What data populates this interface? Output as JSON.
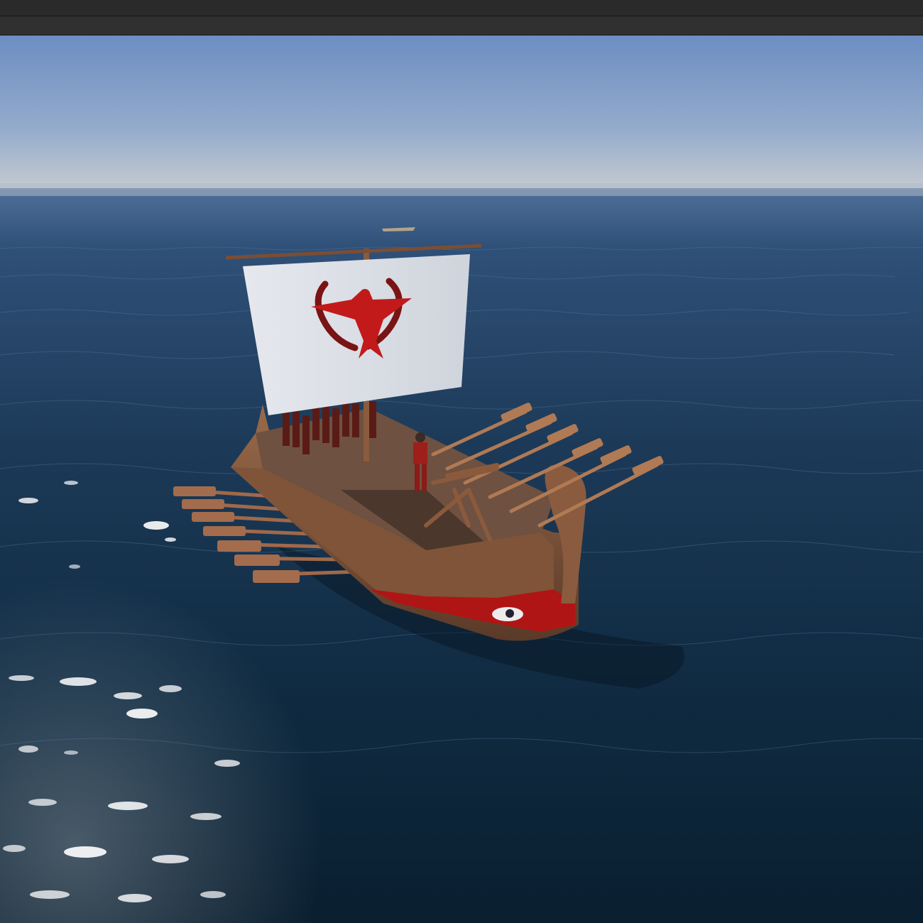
{
  "window": {
    "toolbar_items": []
  },
  "scene": {
    "description_visible_text": [],
    "colors": {
      "sky_top": "#6d8fc2",
      "sky_horizon": "#b8c4cf",
      "sea_far": "#3a5a82",
      "sea_mid": "#1d3a55",
      "sea_near": "#0b2133",
      "hull": "#8a5b3e",
      "hull_dark": "#5e3a26",
      "hull_stripe": "#b01515",
      "deck": "#7a5a44",
      "sail": "#dfe3ea",
      "emblem": "#c21a1a",
      "emblem_dark": "#7a1414"
    },
    "objects": {
      "sail_emblem": "eagle-with-laurel-wreath",
      "ship": "galley-with-oars",
      "catapult": "ballista"
    }
  }
}
